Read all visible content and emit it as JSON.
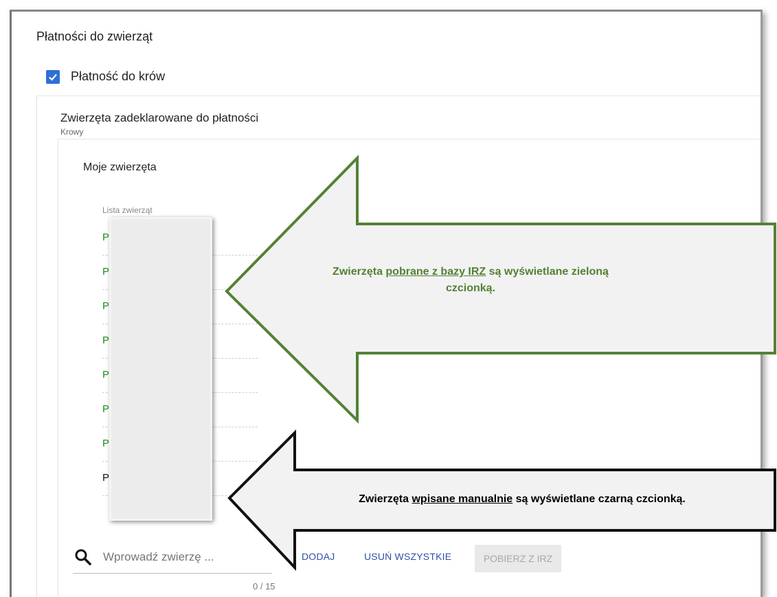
{
  "section": {
    "title": "Płatności do zwierząt"
  },
  "checkbox": {
    "label": "Płatność do krów",
    "checked": true
  },
  "declared": {
    "title": "Zwierzęta zadeklarowane do płatności",
    "subtitle": "Krowy"
  },
  "mine": {
    "title": "Moje zwierzęta",
    "list_header": "Lista zwierząt"
  },
  "animals": [
    {
      "text": "PL",
      "source": "IRZ"
    },
    {
      "text": "PL",
      "source": "IRZ"
    },
    {
      "text": "PL",
      "source": "IRZ"
    },
    {
      "text": "PL",
      "source": "IRZ"
    },
    {
      "text": "PL",
      "source": "IRZ"
    },
    {
      "text": "PL",
      "source": "IRZ"
    },
    {
      "text": "PL",
      "source": "IRZ"
    },
    {
      "text": "PL",
      "source": "manual"
    }
  ],
  "search": {
    "placeholder": "Wprowadź zwierzę ...",
    "counter": "0 / 15"
  },
  "buttons": {
    "add": "DODAJ",
    "remove_all": "USUŃ WSZYSTKIE",
    "fetch_irz": "POBIERZ Z IRZ"
  },
  "callout_green": {
    "before": "Zwierzęta ",
    "underlined": "pobrane z bazy IRZ",
    "after": " są wyświetlane zieloną czcionką.",
    "color": "#538135"
  },
  "callout_black": {
    "before": "Zwierzęta ",
    "underlined": "wpisane manualnie",
    "after": " są wyświetlane czarną czcionką.",
    "color": "#000000"
  },
  "colors": {
    "irz_green": "#1a8f1a",
    "accent_blue": "#2f6fd6",
    "link_blue": "#2f4fa8"
  }
}
